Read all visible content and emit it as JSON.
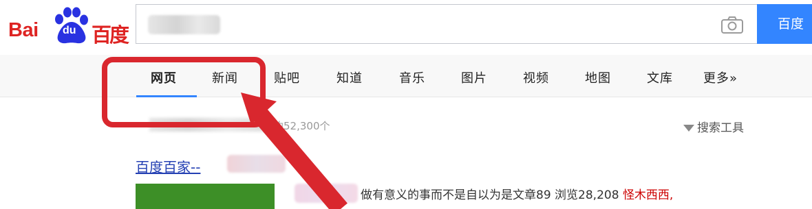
{
  "logo": {
    "latin": "Bai",
    "badge": "du",
    "chinese": "百度"
  },
  "search": {
    "query": "",
    "button_label": "百度"
  },
  "nav": {
    "tabs": [
      "网页",
      "新闻",
      "贴吧",
      "知道",
      "音乐",
      "图片",
      "视频",
      "地图",
      "文库",
      "更多»"
    ],
    "active_index": 0
  },
  "results": {
    "count_text": "约52,300个",
    "tools_label": "搜索工具",
    "first": {
      "title": "百度百家--",
      "snippet": "做有意义的事而不是自以为是文章89 浏览28,208",
      "author": "怪木西西,"
    }
  },
  "colors": {
    "brand_red": "#de2423",
    "brand_blue": "#3385ff",
    "link": "#2440b3",
    "annotation": "#d9272e"
  }
}
